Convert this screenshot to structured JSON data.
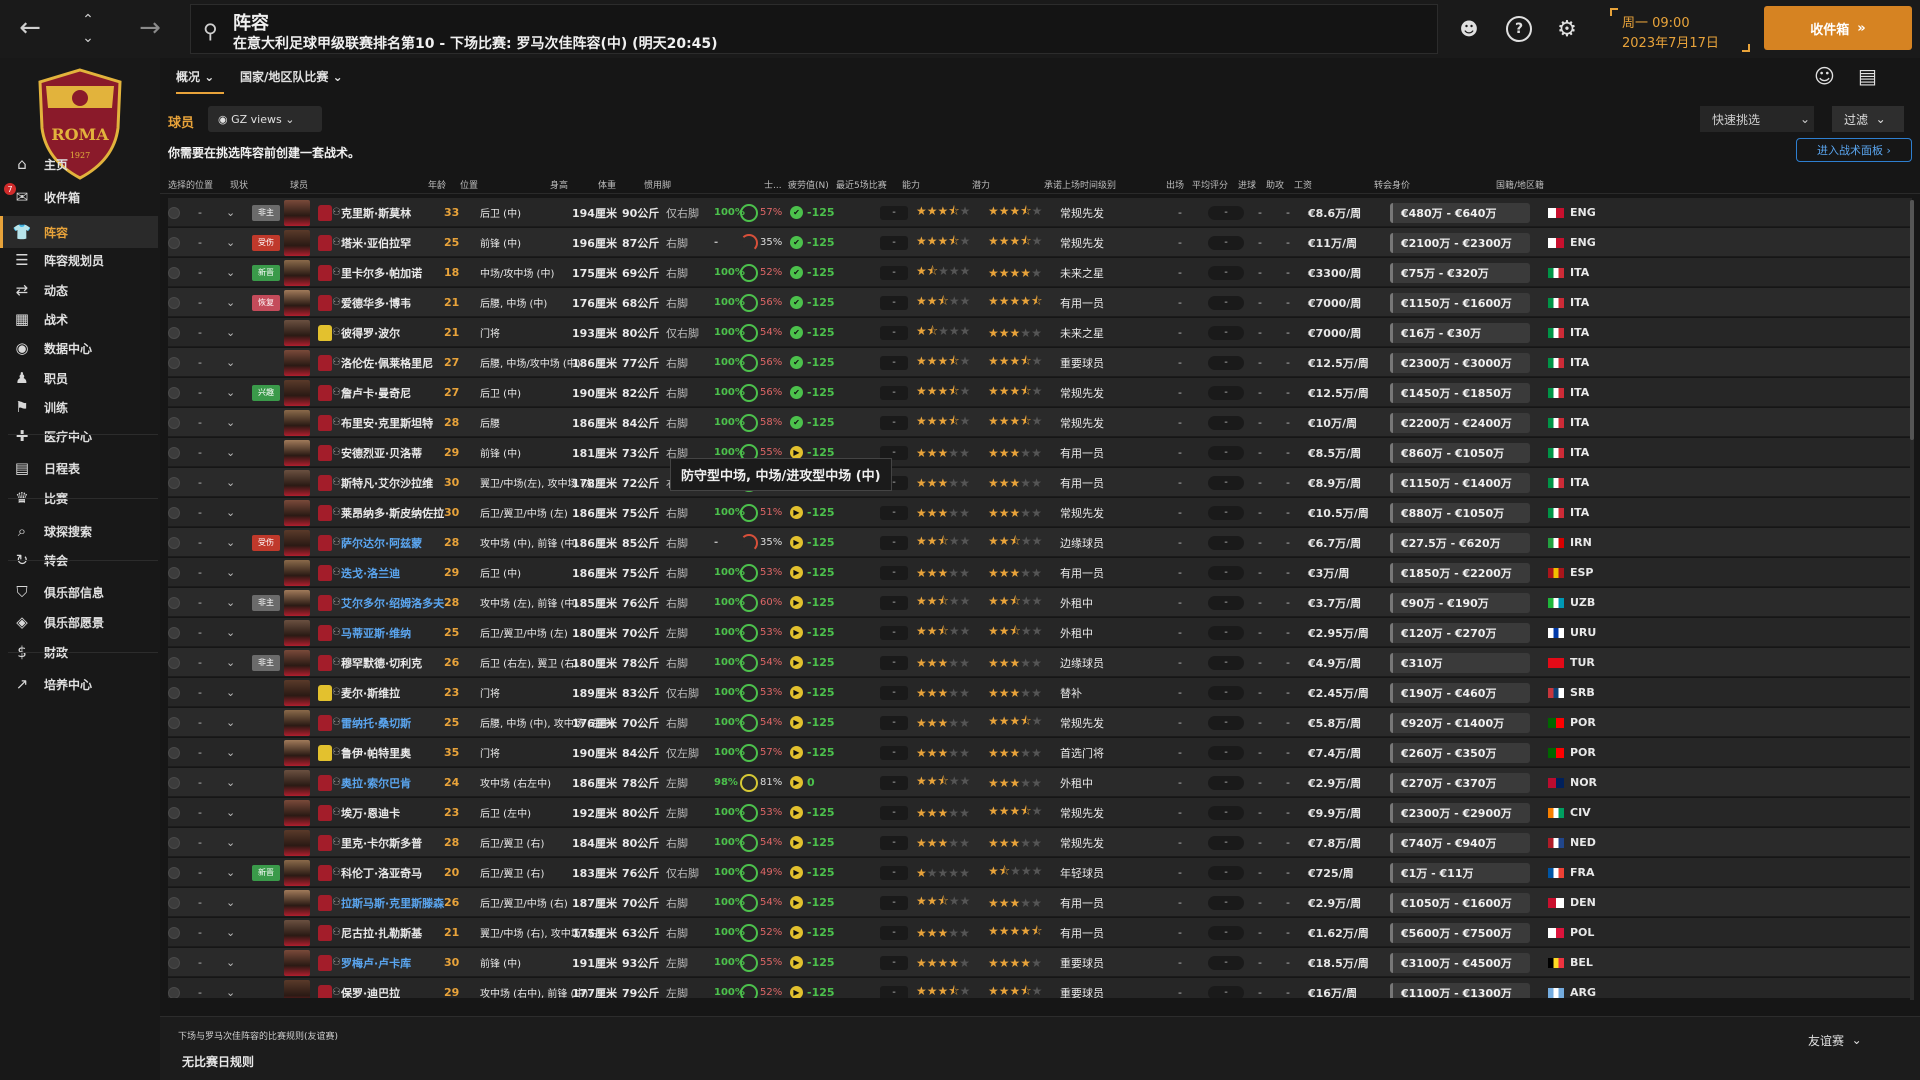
{
  "topbar": {
    "title": "阵容",
    "subtitle": "在意大利足球甲级联赛排名第10 - 下场比赛: 罗马次佳阵容(中) (明天20:45)",
    "date_line1": "周一 09:00",
    "date_line2": "2023年7月17日",
    "inbox_label": "收件箱"
  },
  "sidebar": {
    "badge_count": "7",
    "items": [
      {
        "label": "主页",
        "icon": "home-icon"
      },
      {
        "label": "收件箱",
        "icon": "inbox-icon"
      },
      {
        "label": "阵容",
        "icon": "squad-icon"
      },
      {
        "label": "阵容规划员",
        "icon": "planner-icon"
      },
      {
        "label": "动态",
        "icon": "dynamics-icon"
      },
      {
        "label": "战术",
        "icon": "tactics-icon"
      },
      {
        "label": "数据中心",
        "icon": "data-icon"
      },
      {
        "label": "职员",
        "icon": "staff-icon"
      },
      {
        "label": "训练",
        "icon": "training-icon"
      },
      {
        "label": "医疗中心",
        "icon": "medical-icon"
      },
      {
        "label": "日程表",
        "icon": "calendar-icon"
      },
      {
        "label": "比赛",
        "icon": "trophy-icon"
      },
      {
        "label": "球探搜索",
        "icon": "scout-icon"
      },
      {
        "label": "转会",
        "icon": "transfer-icon"
      },
      {
        "label": "俱乐部信息",
        "icon": "club-info-icon"
      },
      {
        "label": "俱乐部愿景",
        "icon": "vision-icon"
      },
      {
        "label": "财政",
        "icon": "finance-icon"
      },
      {
        "label": "培养中心",
        "icon": "development-icon"
      }
    ]
  },
  "tabs": [
    {
      "label": "概况"
    },
    {
      "label": "国家/地区队比赛"
    }
  ],
  "filters": {
    "players_label": "球员",
    "view_label": "GZ views",
    "quick_pick": "快速挑选",
    "filter_label": "过滤"
  },
  "notice": "你需要在挑选阵容前创建一套战术。",
  "tactics_button": "进入战术面板",
  "columns": [
    "选择的位置",
    "现状",
    "球员",
    "年龄",
    "位置",
    "身高",
    "体重",
    "惯用脚",
    "士...",
    "疲劳值(N)",
    "最近5场比赛",
    "能力",
    "潜力",
    "承诺上场时间级别",
    "出场",
    "平均评分",
    "进球",
    "助攻",
    "工资",
    "转会身价",
    "国籍/地区籍"
  ],
  "tooltip": "防守型中场, 中场/进攻型中场 (中)",
  "players": [
    {
      "status": "非主",
      "status_color": "#6b6b6b",
      "name": "克里斯·斯莫林",
      "loan": false,
      "age": "33",
      "age_hl": true,
      "pos": "后卫 (中)",
      "height": "194厘米",
      "weight": "90公斤",
      "foot": "仅右脚",
      "fit": "100%",
      "sharp": "57%",
      "ring": "full",
      "morale": "-125",
      "ability": [
        3.5
      ],
      "potential": [
        3.5
      ],
      "role": "常规先发",
      "wage": "€8.6万/周",
      "value": "€480万 - €640万",
      "nat": "ENG"
    },
    {
      "status": "受伤",
      "status_color": "#c0392b",
      "name": "塔米·亚伯拉罕",
      "loan": false,
      "age": "25",
      "age_hl": true,
      "pos": "前锋 (中)",
      "height": "196厘米",
      "weight": "87公斤",
      "foot": "右脚",
      "fit": "-",
      "sharp": "35%",
      "ring": "partial",
      "morale": "-125",
      "ability": [
        3.5
      ],
      "potential": [
        3.5
      ],
      "role": "常规先发",
      "wage": "€11万/周",
      "value": "€2100万 - €2300万",
      "nat": "ENG"
    },
    {
      "status": "新晋",
      "status_color": "#3a9a4a",
      "name": "里卡尔多·帕加诺",
      "loan": false,
      "age": "18",
      "age_hl": true,
      "pos": "中场/攻中场 (中)",
      "height": "175厘米",
      "weight": "69公斤",
      "foot": "右脚",
      "fit": "100%",
      "sharp": "52%",
      "ring": "full",
      "morale": "-125",
      "ability": [
        1.5
      ],
      "potential": [
        4
      ],
      "role": "未来之星",
      "wage": "€3300/周",
      "value": "€75万 - €320万",
      "nat": "ITA"
    },
    {
      "status": "恢复",
      "status_color": "#c44b5a",
      "name": "爱德华多·博韦",
      "loan": false,
      "age": "21",
      "age_hl": true,
      "pos": "后腰, 中场 (中)",
      "height": "176厘米",
      "weight": "68公斤",
      "foot": "右脚",
      "fit": "100%",
      "sharp": "56%",
      "ring": "full",
      "morale": "-125",
      "ability": [
        2.5
      ],
      "potential": [
        4.5
      ],
      "role": "有用一员",
      "wage": "€7000/周",
      "value": "€1150万 - €1600万",
      "nat": "ITA"
    },
    {
      "status": "",
      "status_color": "",
      "name": "彼得罗·波尔",
      "loan": false,
      "gk": true,
      "age": "21",
      "age_hl": true,
      "pos": "门将",
      "height": "193厘米",
      "weight": "80公斤",
      "foot": "仅右脚",
      "fit": "100%",
      "sharp": "54%",
      "ring": "full",
      "morale": "-125",
      "ability": [
        1.5
      ],
      "potential": [
        3
      ],
      "role": "未来之星",
      "wage": "€7000/周",
      "value": "€16万 - €30万",
      "nat": "ITA"
    },
    {
      "status": "",
      "status_color": "",
      "name": "洛伦佐·佩莱格里尼",
      "loan": false,
      "age": "27",
      "age_hl": true,
      "pos": "后腰, 中场/攻中场 (中)",
      "height": "186厘米",
      "weight": "77公斤",
      "foot": "右脚",
      "fit": "100%",
      "sharp": "56%",
      "ring": "full",
      "morale": "-125",
      "ability": [
        3.5
      ],
      "potential": [
        3.5
      ],
      "role": "重要球员",
      "wage": "€12.5万/周",
      "value": "€2300万 - €3000万",
      "nat": "ITA"
    },
    {
      "status": "兴趣",
      "status_color": "#3a9a4a",
      "name": "詹卢卡·曼奇尼",
      "loan": false,
      "age": "27",
      "age_hl": true,
      "pos": "后卫 (中)",
      "height": "190厘米",
      "weight": "82公斤",
      "foot": "右脚",
      "fit": "100%",
      "sharp": "56%",
      "ring": "full",
      "morale": "-125",
      "ability": [
        3.5
      ],
      "potential": [
        3.5
      ],
      "role": "常规先发",
      "wage": "€12.5万/周",
      "value": "€1450万 - €1850万",
      "nat": "ITA"
    },
    {
      "status": "",
      "status_color": "",
      "name": "布里安·克里斯坦特",
      "loan": false,
      "age": "28",
      "age_hl": true,
      "pos": "后腰",
      "height": "186厘米",
      "weight": "84公斤",
      "foot": "右脚",
      "fit": "100%",
      "sharp": "58%",
      "ring": "full",
      "morale": "-125",
      "ability": [
        3.5
      ],
      "potential": [
        3.5
      ],
      "role": "常规先发",
      "wage": "€10万/周",
      "value": "€2200万 - €2400万",
      "nat": "ITA"
    },
    {
      "status": "",
      "status_color": "",
      "name": "安德烈亚·贝洛蒂",
      "loan": false,
      "age": "29",
      "age_hl": true,
      "pos": "前锋 (中)",
      "height": "181厘米",
      "weight": "73公斤",
      "foot": "右脚",
      "fit": "100%",
      "sharp": "55%",
      "ring": "full",
      "morale": "-125",
      "ability": [
        3
      ],
      "potential": [
        3
      ],
      "role": "有用一员",
      "wage": "€8.5万/周",
      "value": "€860万 - €1050万",
      "nat": "ITA"
    },
    {
      "status": "",
      "status_color": "",
      "name": "斯特凡·艾尔沙拉维",
      "loan": false,
      "age": "30",
      "age_hl": true,
      "pos": "翼卫/中场(左), 攻中场 (左)",
      "height": "178厘米",
      "weight": "72公斤",
      "foot": "右脚",
      "fit": "100%",
      "sharp": "52%",
      "ring": "full",
      "morale": "-125",
      "ability": [
        3
      ],
      "potential": [
        3
      ],
      "role": "有用一员",
      "wage": "€8.9万/周",
      "value": "€1150万 - €1400万",
      "nat": "ITA"
    },
    {
      "status": "",
      "status_color": "",
      "name": "莱昂纳多·斯皮纳佐拉",
      "loan": false,
      "age": "30",
      "age_hl": true,
      "pos": "后卫/翼卫/中场 (左)",
      "height": "186厘米",
      "weight": "75公斤",
      "foot": "右脚",
      "fit": "100%",
      "sharp": "51%",
      "ring": "full",
      "morale": "-125",
      "ability": [
        3
      ],
      "potential": [
        3
      ],
      "role": "常规先发",
      "wage": "€10.5万/周",
      "value": "€880万 - €1050万",
      "nat": "ITA"
    },
    {
      "status": "受伤",
      "status_color": "#c0392b",
      "name": "萨尔达尔·阿兹蒙",
      "loan": true,
      "age": "28",
      "age_hl": true,
      "pos": "攻中场 (中), 前锋 (中)",
      "height": "186厘米",
      "weight": "85公斤",
      "foot": "右脚",
      "fit": "-",
      "sharp": "35%",
      "ring": "partial",
      "morale": "-125",
      "ability": [
        2.5
      ],
      "potential": [
        2.5
      ],
      "role": "边缘球员",
      "wage": "€6.7万/周",
      "value": "€27.5万 - €620万",
      "nat": "IRN"
    },
    {
      "status": "",
      "status_color": "",
      "name": "迭戈·洛兰迪",
      "loan": true,
      "age": "29",
      "age_hl": true,
      "pos": "后卫 (中)",
      "height": "186厘米",
      "weight": "75公斤",
      "foot": "右脚",
      "fit": "100%",
      "sharp": "53%",
      "ring": "full",
      "morale": "-125",
      "ability": [
        3
      ],
      "potential": [
        3
      ],
      "role": "有用一员",
      "wage": "€3万/周",
      "value": "€1850万 - €2200万",
      "nat": "ESP"
    },
    {
      "status": "非主",
      "status_color": "#6b6b6b",
      "name": "艾尔多尔·绍姆洛多夫",
      "loan": true,
      "age": "28",
      "age_hl": true,
      "pos": "攻中场 (左), 前锋 (中)",
      "height": "185厘米",
      "weight": "76公斤",
      "foot": "右脚",
      "fit": "100%",
      "sharp": "60%",
      "ring": "full",
      "morale": "-125",
      "ability": [
        2.5
      ],
      "potential": [
        2.5
      ],
      "role": "外租中",
      "wage": "€3.7万/周",
      "value": "€90万 - €190万",
      "nat": "UZB"
    },
    {
      "status": "",
      "status_color": "",
      "name": "马蒂亚斯·维纳",
      "loan": true,
      "age": "25",
      "age_hl": true,
      "pos": "后卫/翼卫/中场 (左)",
      "height": "180厘米",
      "weight": "70公斤",
      "foot": "左脚",
      "fit": "100%",
      "sharp": "53%",
      "ring": "full",
      "morale": "-125",
      "ability": [
        2.5
      ],
      "potential": [
        2.5
      ],
      "role": "外租中",
      "wage": "€2.95万/周",
      "value": "€120万 - €270万",
      "nat": "URU"
    },
    {
      "status": "非主",
      "status_color": "#6b6b6b",
      "name": "穆罕默德·切利克",
      "loan": false,
      "age": "26",
      "age_hl": true,
      "pos": "后卫 (右左), 翼卫 (右)",
      "height": "180厘米",
      "weight": "78公斤",
      "foot": "右脚",
      "fit": "100%",
      "sharp": "54%",
      "ring": "full",
      "morale": "-125",
      "ability": [
        3
      ],
      "potential": [
        3
      ],
      "role": "边缘球员",
      "wage": "€4.9万/周",
      "value": "€310万",
      "nat": "TUR"
    },
    {
      "status": "",
      "status_color": "",
      "name": "麦尔·斯维拉",
      "loan": false,
      "gk": true,
      "age": "23",
      "age_hl": true,
      "pos": "门将",
      "height": "189厘米",
      "weight": "83公斤",
      "foot": "仅右脚",
      "fit": "100%",
      "sharp": "53%",
      "ring": "full",
      "morale": "-125",
      "ability": [
        3
      ],
      "potential": [
        3
      ],
      "role": "替补",
      "wage": "€2.45万/周",
      "value": "€190万 - €460万",
      "nat": "SRB"
    },
    {
      "status": "",
      "status_color": "",
      "name": "雷纳托·桑切斯",
      "loan": true,
      "age": "25",
      "age_hl": true,
      "pos": "后腰, 中场 (中), 攻中场 (右中)",
      "height": "176厘米",
      "weight": "70公斤",
      "foot": "右脚",
      "fit": "100%",
      "sharp": "54%",
      "ring": "full",
      "morale": "-125",
      "ability": [
        3
      ],
      "potential": [
        3.5
      ],
      "role": "常规先发",
      "wage": "€5.8万/周",
      "value": "€920万 - €1400万",
      "nat": "POR"
    },
    {
      "status": "",
      "status_color": "",
      "name": "鲁伊·帕特里奥",
      "loan": false,
      "gk": true,
      "age": "35",
      "age_hl": true,
      "pos": "门将",
      "height": "190厘米",
      "weight": "84公斤",
      "foot": "仅左脚",
      "fit": "100%",
      "sharp": "57%",
      "ring": "full",
      "morale": "-125",
      "ability": [
        3
      ],
      "potential": [
        3
      ],
      "role": "首选门将",
      "wage": "€7.4万/周",
      "value": "€260万 - €350万",
      "nat": "POR"
    },
    {
      "status": "",
      "status_color": "",
      "name": "奥拉·索尔巴肯",
      "loan": true,
      "age": "24",
      "age_hl": true,
      "pos": "攻中场 (右左中)",
      "height": "186厘米",
      "weight": "78公斤",
      "foot": "左脚",
      "fit": "98%",
      "sharp": "81%",
      "ring": "yellow",
      "morale": "0",
      "ability": [
        2.5
      ],
      "potential": [
        3
      ],
      "role": "外租中",
      "wage": "€2.9万/周",
      "value": "€270万 - €370万",
      "nat": "NOR"
    },
    {
      "status": "",
      "status_color": "",
      "name": "埃万·恩迪卡",
      "loan": false,
      "age": "23",
      "age_hl": true,
      "pos": "后卫 (左中)",
      "height": "192厘米",
      "weight": "80公斤",
      "foot": "左脚",
      "fit": "100%",
      "sharp": "53%",
      "ring": "full",
      "morale": "-125",
      "ability": [
        3
      ],
      "potential": [
        3.5
      ],
      "role": "常规先发",
      "wage": "€9.9万/周",
      "value": "€2300万 - €2900万",
      "nat": "CIV"
    },
    {
      "status": "",
      "status_color": "",
      "name": "里克·卡尔斯多普",
      "loan": false,
      "age": "28",
      "age_hl": true,
      "pos": "后卫/翼卫 (右)",
      "height": "184厘米",
      "weight": "80公斤",
      "foot": "右脚",
      "fit": "100%",
      "sharp": "54%",
      "ring": "full",
      "morale": "-125",
      "ability": [
        3
      ],
      "potential": [
        3
      ],
      "role": "常规先发",
      "wage": "€7.8万/周",
      "value": "€740万 - €940万",
      "nat": "NED"
    },
    {
      "status": "新晋",
      "status_color": "#3a9a4a",
      "name": "科伦丁·洛亚奇马",
      "loan": false,
      "age": "20",
      "age_hl": true,
      "pos": "后卫/翼卫 (右)",
      "height": "183厘米",
      "weight": "76公斤",
      "foot": "仅右脚",
      "fit": "100%",
      "sharp": "49%",
      "ring": "full",
      "morale": "-125",
      "ability": [
        1
      ],
      "potential": [
        1.5
      ],
      "role": "年轻球员",
      "wage": "€725/周",
      "value": "€1万 - €11万",
      "nat": "FRA"
    },
    {
      "status": "",
      "status_color": "",
      "name": "拉斯马斯·克里斯滕森",
      "loan": true,
      "age": "26",
      "age_hl": true,
      "pos": "后卫/翼卫/中场 (右)",
      "height": "187厘米",
      "weight": "70公斤",
      "foot": "右脚",
      "fit": "100%",
      "sharp": "54%",
      "ring": "full",
      "morale": "-125",
      "ability": [
        2.5
      ],
      "potential": [
        3
      ],
      "role": "有用一员",
      "wage": "€2.9万/周",
      "value": "€1050万 - €1600万",
      "nat": "DEN"
    },
    {
      "status": "",
      "status_color": "",
      "name": "尼古拉·扎勒斯基",
      "loan": false,
      "age": "21",
      "age_hl": true,
      "pos": "翼卫/中场 (右), 攻中场 (右)",
      "height": "175厘米",
      "weight": "63公斤",
      "foot": "右脚",
      "fit": "100%",
      "sharp": "52%",
      "ring": "full",
      "morale": "-125",
      "ability": [
        3
      ],
      "potential": [
        4.5
      ],
      "role": "有用一员",
      "wage": "€1.62万/周",
      "value": "€5600万 - €7500万",
      "nat": "POL"
    },
    {
      "status": "",
      "status_color": "",
      "name": "罗梅卢·卢卡库",
      "loan": true,
      "age": "30",
      "age_hl": true,
      "pos": "前锋 (中)",
      "height": "191厘米",
      "weight": "93公斤",
      "foot": "左脚",
      "fit": "100%",
      "sharp": "55%",
      "ring": "full",
      "morale": "-125",
      "ability": [
        4
      ],
      "potential": [
        4
      ],
      "role": "重要球员",
      "wage": "€18.5万/周",
      "value": "€3100万 - €4500万",
      "nat": "BEL"
    },
    {
      "status": "",
      "status_color": "",
      "name": "保罗·迪巴拉",
      "loan": false,
      "age": "29",
      "age_hl": true,
      "pos": "攻中场 (右中), 前锋 (中)",
      "height": "177厘米",
      "weight": "79公斤",
      "foot": "左脚",
      "fit": "100%",
      "sharp": "52%",
      "ring": "full",
      "morale": "-125",
      "ability": [
        3.5
      ],
      "potential": [
        3.5
      ],
      "role": "重要球员",
      "wage": "€16万/周",
      "value": "€1100万 - €1300万",
      "nat": "ARG"
    }
  ],
  "footer": {
    "line1": "下场与罗马次佳阵容的比赛规则(友谊赛)",
    "line2": "无比赛日规则",
    "friendly": "友谊赛"
  },
  "colors": {
    "accent": "#e8a33a",
    "loan_blue": "#5aa5ef",
    "fit_green": "#4cc14c"
  }
}
